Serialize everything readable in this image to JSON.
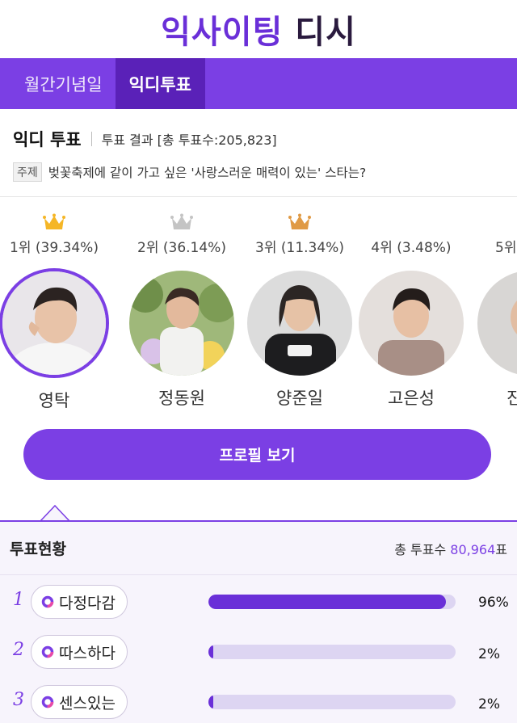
{
  "header": {
    "logo_part1": "익사이팅",
    "logo_part2": "디시"
  },
  "tabs": [
    {
      "label": "월간기념일",
      "active": false
    },
    {
      "label": "익디투표",
      "active": true
    }
  ],
  "vote": {
    "title": "익디 투표",
    "result_label": "투표 결과 [총 투표수:205,823]",
    "topic_badge": "주제",
    "topic": "벚꽃축제에 같이 가고 싶은 '사랑스러운 매력이 있는' 스타는?"
  },
  "ranking": [
    {
      "rank_text": "1위 (39.34%)",
      "name": "영탁",
      "crown": "gold-crown-icon",
      "crown_color": "#f5b626"
    },
    {
      "rank_text": "2위 (36.14%)",
      "name": "정동원",
      "crown": "silver-crown-icon",
      "crown_color": "#c4c4c4"
    },
    {
      "rank_text": "3위 (11.34%)",
      "name": "양준일",
      "crown": "bronze-crown-icon",
      "crown_color": "#e09a45"
    },
    {
      "rank_text": "4위 (3.48%)",
      "name": "고은성",
      "crown": "",
      "crown_color": ""
    },
    {
      "rank_text": "5위",
      "name": "진",
      "crown": "",
      "crown_color": ""
    }
  ],
  "profile_button": "프로필 보기",
  "status": {
    "title": "투표현황",
    "total_label": "총 투표수",
    "total_value": "80,964",
    "total_unit": "표",
    "items": [
      {
        "rank": "1",
        "keyword": "다정다감",
        "percent_text": "96%",
        "percent": 96
      },
      {
        "rank": "2",
        "keyword": "따스하다",
        "percent_text": "2%",
        "percent": 2
      },
      {
        "rank": "3",
        "keyword": "센스있는",
        "percent_text": "2%",
        "percent": 2
      }
    ]
  },
  "colors": {
    "accent": "#7b3fe4",
    "accent_dark": "#5a21b8",
    "bar_track": "#ddd5f2"
  }
}
